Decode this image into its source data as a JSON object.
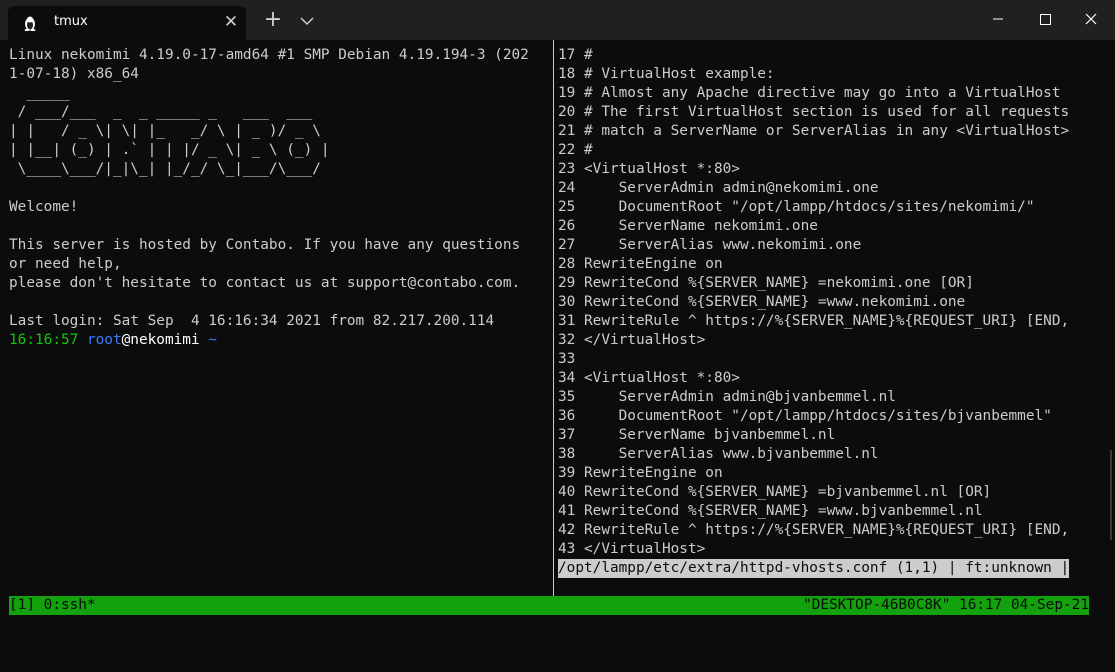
{
  "window": {
    "tab_title": "tmux",
    "tab_icon": "linux-penguin-icon",
    "new_tab_label": "+",
    "close_tab_label": "✕"
  },
  "left_pane": {
    "lines": [
      "Linux nekomimi 4.19.0-17-amd64 #1 SMP Debian 4.19.194-3 (202",
      "1-07-18) x86_64",
      "  _____",
      " / ___/___  _  _ _____ _   ___  ___",
      "| |   / _ \\| \\| |_   _/ \\ | _ )/ _ \\",
      "| |__| (_) | .` | | |/ _ \\| _ \\ (_) |",
      " \\____\\___/|_|\\_| |_/_/ \\_|___/\\___/",
      "",
      "Welcome!",
      "",
      "This server is hosted by Contabo. If you have any questions",
      "or need help,",
      "please don't hesitate to contact us at support@contabo.com.",
      "",
      "Last login: Sat Sep  4 16:16:34 2021 from 82.217.200.114"
    ],
    "prompt": {
      "time": "16:16:57",
      "user": "root",
      "host": "@nekomimi",
      "path": "~"
    }
  },
  "right_pane": {
    "lines": [
      "17 #",
      "18 # VirtualHost example:",
      "19 # Almost any Apache directive may go into a VirtualHost",
      "20 # The first VirtualHost section is used for all requests",
      "21 # match a ServerName or ServerAlias in any <VirtualHost>",
      "22 #",
      "23 <VirtualHost *:80>",
      "24     ServerAdmin admin@nekomimi.one",
      "25     DocumentRoot \"/opt/lampp/htdocs/sites/nekomimi/\"",
      "26     ServerName nekomimi.one",
      "27     ServerAlias www.nekomimi.one",
      "28 RewriteEngine on",
      "29 RewriteCond %{SERVER_NAME} =nekomimi.one [OR]",
      "30 RewriteCond %{SERVER_NAME} =www.nekomimi.one",
      "31 RewriteRule ^ https://%{SERVER_NAME}%{REQUEST_URI} [END,",
      "32 </VirtualHost>",
      "33",
      "34 <VirtualHost *:80>",
      "35     ServerAdmin admin@bjvanbemmel.nl",
      "36     DocumentRoot \"/opt/lampp/htdocs/sites/bjvanbemmel\"",
      "37     ServerName bjvanbemmel.nl",
      "38     ServerAlias www.bjvanbemmel.nl",
      "39 RewriteEngine on",
      "40 RewriteCond %{SERVER_NAME} =bjvanbemmel.nl [OR]",
      "41 RewriteCond %{SERVER_NAME} =www.bjvanbemmel.nl",
      "42 RewriteRule ^ https://%{SERVER_NAME}%{REQUEST_URI} [END,",
      "43 </VirtualHost>"
    ],
    "status_line": "/opt/lampp/etc/extra/httpd-vhosts.conf (1,1) | ft:unknown |"
  },
  "tmux_status": {
    "left": "[1] 0:ssh*",
    "right": "\"DESKTOP-46B0C8K\" 16:17 04-Sep-21",
    "color": "#13a10e"
  },
  "colors": {
    "background": "#0c0c0c",
    "foreground": "#cccccc",
    "prompt_time": "#16c60c",
    "prompt_user": "#3b78ff"
  }
}
